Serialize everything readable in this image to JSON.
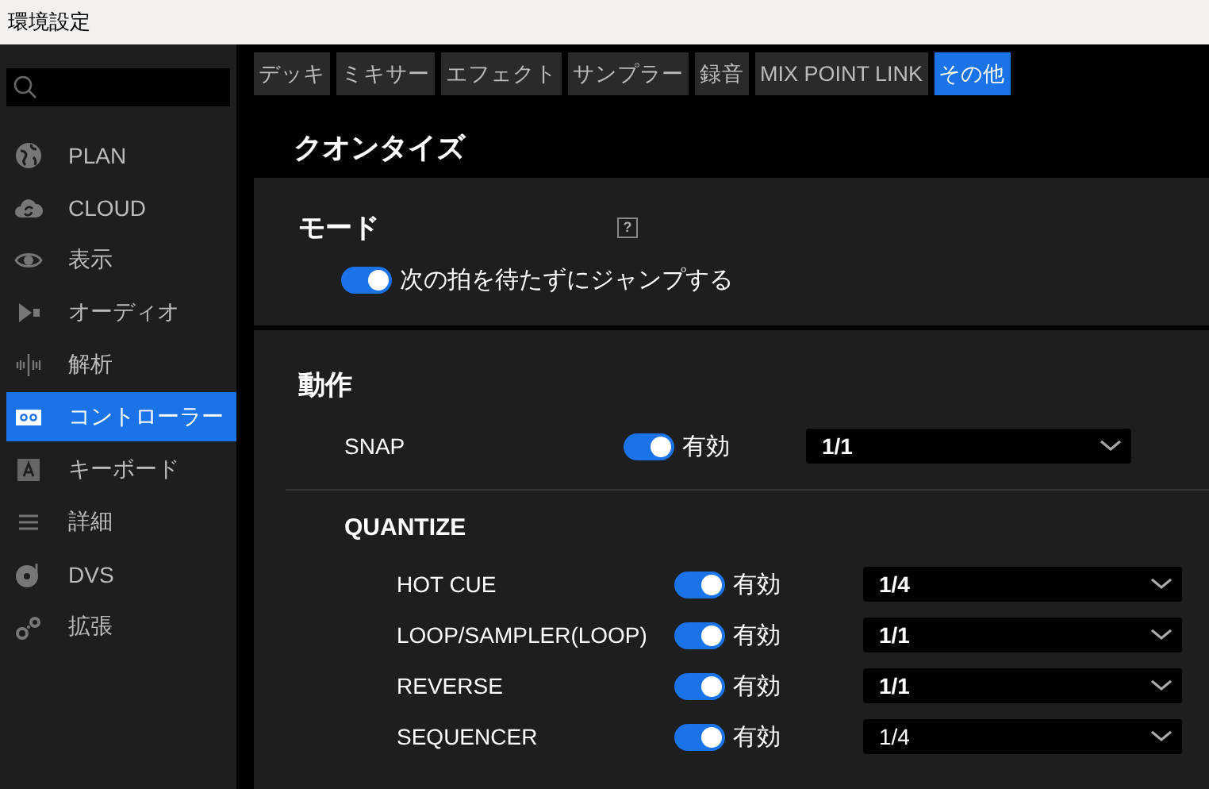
{
  "window": {
    "title": "環境設定"
  },
  "sidebar": {
    "items": [
      {
        "label": "PLAN",
        "selected": false
      },
      {
        "label": "CLOUD",
        "selected": false
      },
      {
        "label": "表示",
        "selected": false
      },
      {
        "label": "オーディオ",
        "selected": false
      },
      {
        "label": "解析",
        "selected": false
      },
      {
        "label": "コントローラー",
        "selected": true
      },
      {
        "label": "キーボード",
        "selected": false
      },
      {
        "label": "詳細",
        "selected": false
      },
      {
        "label": "DVS",
        "selected": false
      },
      {
        "label": "拡張",
        "selected": false
      }
    ]
  },
  "tabs": [
    {
      "label": "デッキ",
      "selected": false
    },
    {
      "label": "ミキサー",
      "selected": false
    },
    {
      "label": "エフェクト",
      "selected": false
    },
    {
      "label": "サンプラー",
      "selected": false
    },
    {
      "label": "録音",
      "selected": false
    },
    {
      "label": "MIX POINT LINK",
      "selected": false
    },
    {
      "label": "その他",
      "selected": true
    }
  ],
  "section_title": "クオンタイズ",
  "mode_panel": {
    "title": "モード",
    "help": "?",
    "option": {
      "label": "次の拍を待たずにジャンプする",
      "on": true
    }
  },
  "action_panel": {
    "title": "動作",
    "snap": {
      "label": "SNAP",
      "on": true,
      "toggle_label": "有効",
      "value": "1/1",
      "emphasized": true
    },
    "quantize": {
      "title": "QUANTIZE",
      "rows": [
        {
          "label": "HOT CUE",
          "on": true,
          "toggle_label": "有効",
          "value": "1/4",
          "emphasized": true
        },
        {
          "label": "LOOP/SAMPLER(LOOP)",
          "on": true,
          "toggle_label": "有効",
          "value": "1/1",
          "emphasized": true
        },
        {
          "label": "REVERSE",
          "on": true,
          "toggle_label": "有効",
          "value": "1/1",
          "emphasized": true
        },
        {
          "label": "SEQUENCER",
          "on": true,
          "toggle_label": "有効",
          "value": "1/4",
          "emphasized": false
        }
      ]
    }
  }
}
